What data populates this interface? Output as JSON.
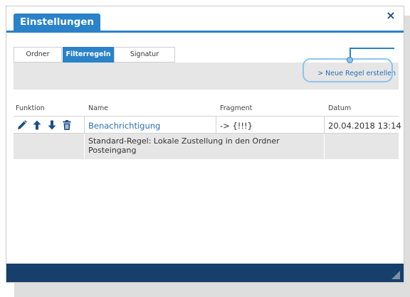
{
  "dialog": {
    "title": "Einstellungen",
    "close_glyph": "×",
    "close_icon": "close-icon"
  },
  "tabs": [
    {
      "label": "Ordner",
      "active": false
    },
    {
      "label": "Filterregeln",
      "active": true
    },
    {
      "label": "Signatur",
      "active": false
    }
  ],
  "toolbar": {
    "new_rule_label": "> Neue Regel erstellen"
  },
  "table": {
    "headers": {
      "function": "Funktion",
      "name": "Name",
      "fragment": "Fragment",
      "date": "Datum"
    },
    "rows": [
      {
        "icons": [
          "edit-icon",
          "arrow-up-icon",
          "arrow-down-icon",
          "trash-icon"
        ],
        "name": "Benachrichtigung",
        "fragment": "-> {!!!}",
        "date": "20.04.2018 13:14",
        "description": "Standard-Regel: Lokale Zustellung in den Ordner Posteingang"
      }
    ]
  },
  "colors": {
    "accent": "#2a82c9",
    "footer": "#163f6b",
    "highlight": "#8dc4ef",
    "link": "#2a6fb5"
  }
}
